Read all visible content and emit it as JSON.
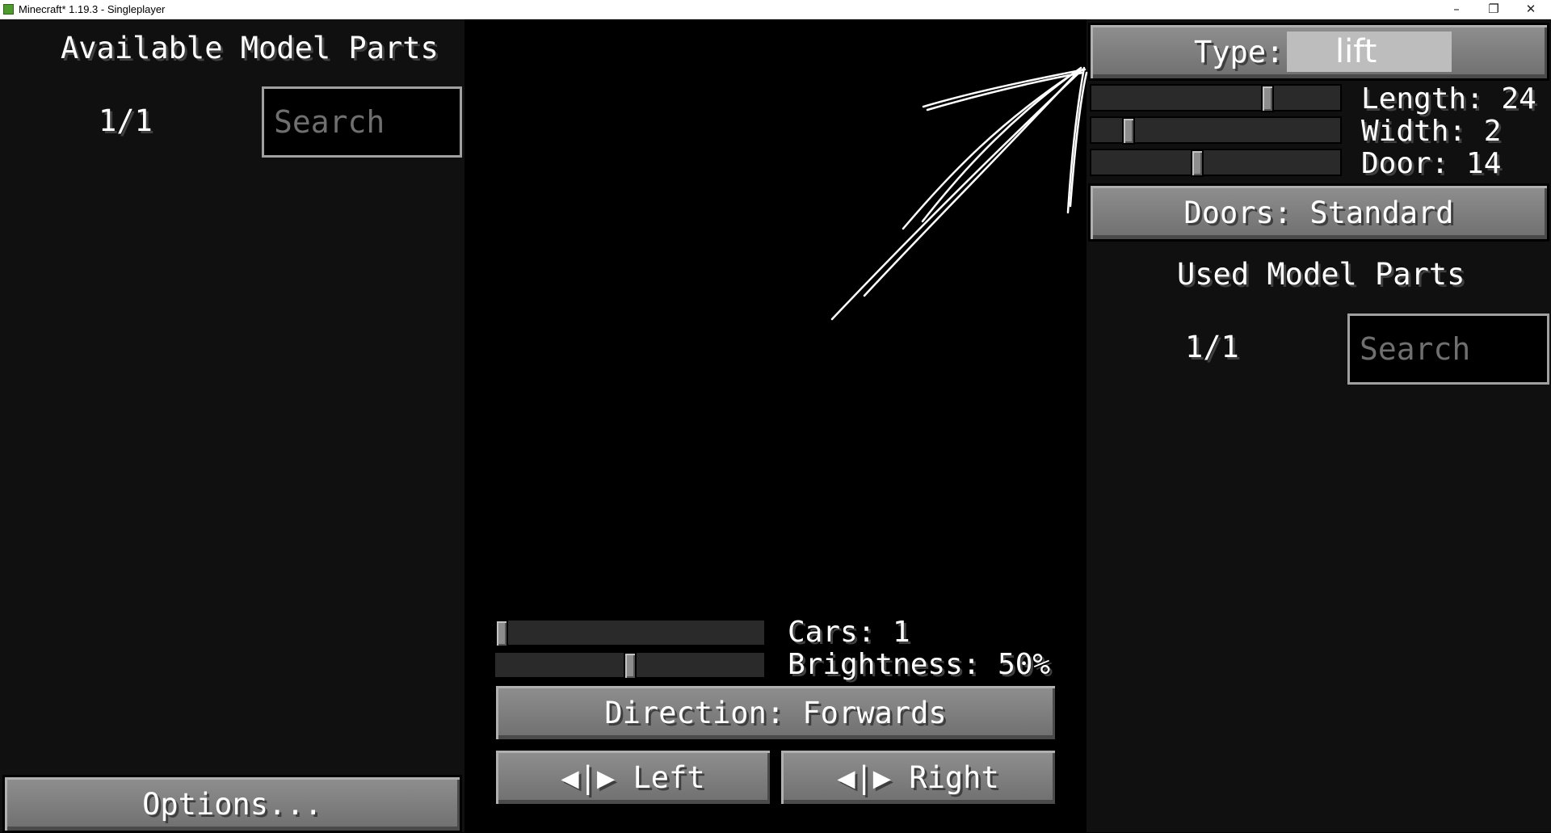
{
  "window": {
    "title": "Minecraft* 1.19.3 - Singleplayer",
    "minimize": "–",
    "maximize": "❐",
    "close": "✕"
  },
  "left_panel": {
    "heading": "Available Model Parts",
    "pager": "1/1",
    "search_placeholder": "Search",
    "options_label": "Options..."
  },
  "right_panel": {
    "type_label": "Type:",
    "type_value": "lift",
    "sliders": [
      {
        "label": "Length: 24",
        "level": 0.72
      },
      {
        "label": "Width: 2",
        "level": 0.13
      },
      {
        "label": "Door: 14",
        "level": 0.42
      }
    ],
    "doors_label": "Doors: Standard",
    "heading": "Used Model Parts",
    "pager": "1/1",
    "search_placeholder": "Search"
  },
  "center": {
    "sliders": [
      {
        "label": "Cars: 1",
        "level": 0.0
      },
      {
        "label": "Brightness: 50%",
        "level": 0.5
      }
    ],
    "direction_label": "Direction: Forwards",
    "left_label": "◀|▶ Left",
    "right_label": "◀|▶ Right"
  },
  "colors": {
    "panel": "#101010",
    "button": "#7f7f7f",
    "type_field": "#bdbdbd"
  }
}
